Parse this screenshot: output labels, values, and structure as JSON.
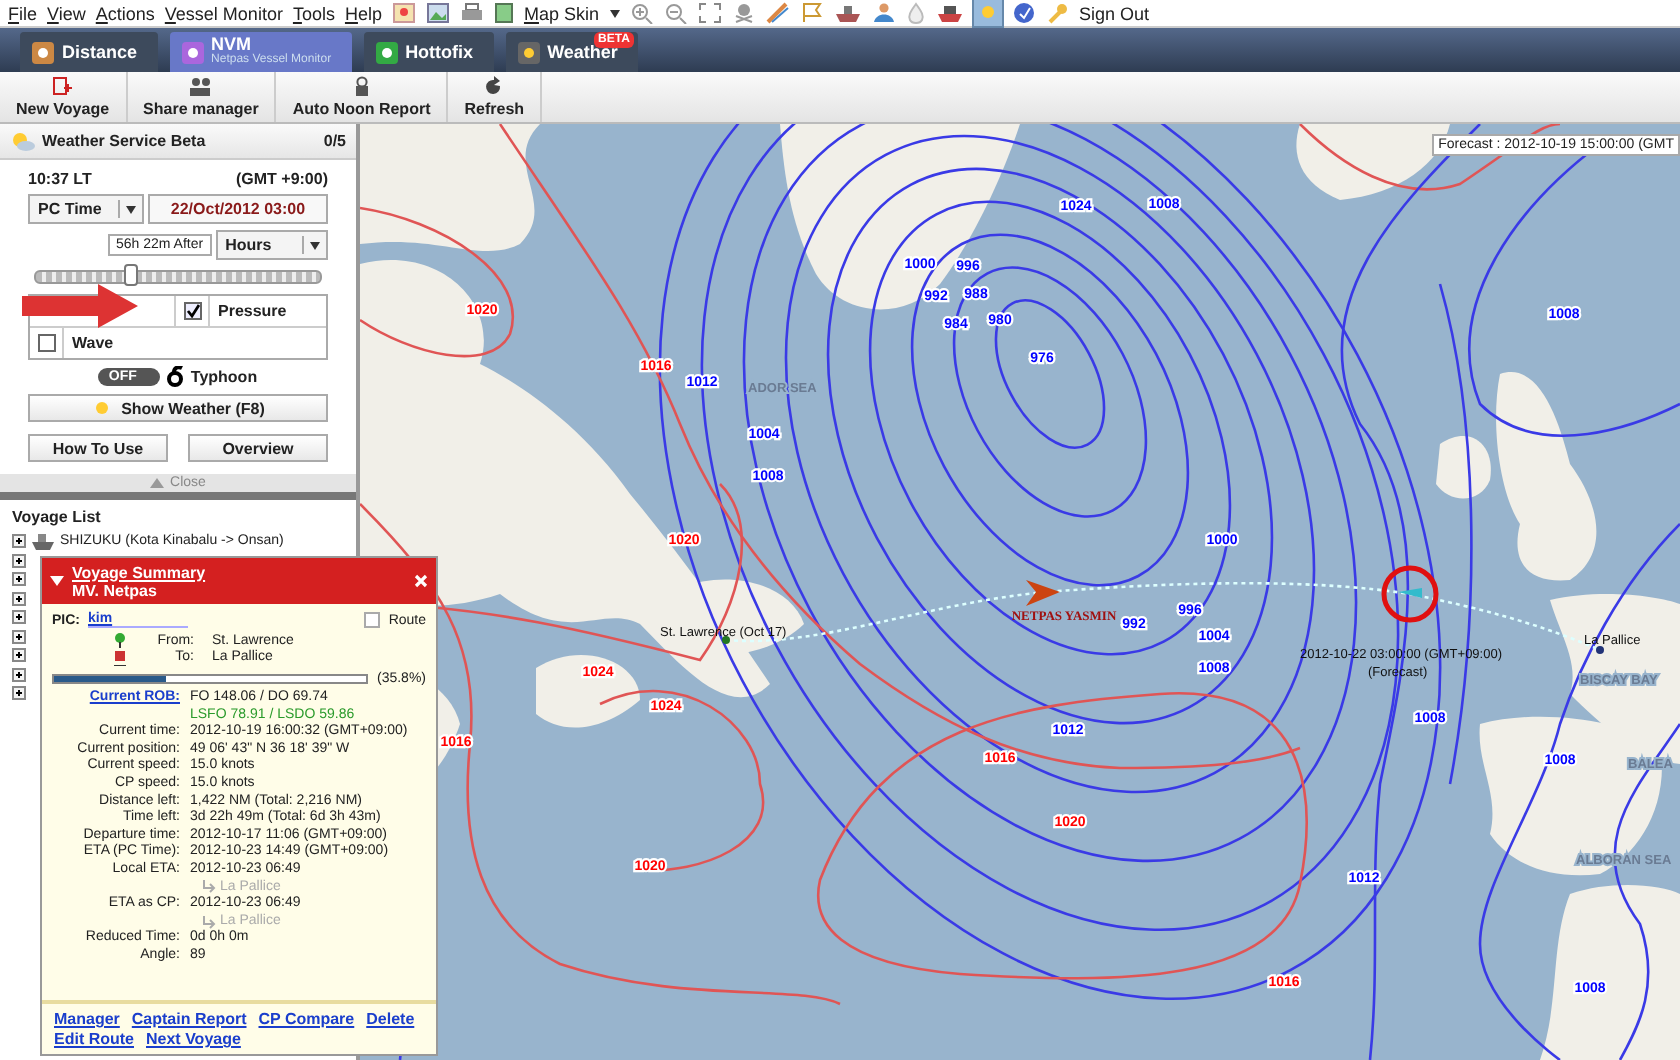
{
  "menu_bar": {
    "items": [
      "File",
      "View",
      "Actions",
      "Vessel Monitor",
      "Tools",
      "Help"
    ],
    "map_skin": "Map Skin",
    "sign_out": "Sign Out"
  },
  "tabs": [
    {
      "label": "Distance",
      "selected": false
    },
    {
      "label": "NVM",
      "sublabel": "Netpas Vessel Monitor",
      "selected": true
    },
    {
      "label": "Hottofix",
      "selected": false
    },
    {
      "label": "Weather",
      "badge": "BETA",
      "selected": false
    }
  ],
  "toolbar": [
    "New Voyage",
    "Share manager",
    "Auto Noon Report",
    "Refresh"
  ],
  "weather_panel": {
    "title": "Weather Service Beta",
    "count": "0/5",
    "local_time": "10:37 LT",
    "gmt": "(GMT +9:00)",
    "time_mode": "PC Time",
    "date": "22/Oct/2012 03:00",
    "offset": "56h 22m After",
    "unit": "Hours",
    "slider": {
      "level": 0.34
    },
    "layers": [
      {
        "label": "Pressure",
        "checked": true
      },
      {
        "label": "Wave",
        "checked": false
      }
    ],
    "typhoon": {
      "switch": "OFF",
      "on": false,
      "label": "Typhoon"
    },
    "show_button": "Show Weather (F8)",
    "buttons": [
      "How To Use",
      "Overview"
    ],
    "close": "Close"
  },
  "voyage_list": {
    "title": "Voyage List",
    "items": [
      {
        "name": "SHIZUKU (Kota Kinabalu -> Onsan)",
        "expanded": false
      },
      {
        "expanded": false
      },
      {
        "expanded": false
      },
      {
        "expanded": false
      },
      {
        "expanded": false
      },
      {
        "expanded": false
      },
      {
        "expanded": false
      },
      {
        "expanded": false
      },
      {
        "expanded": false
      }
    ]
  },
  "voyage_summary": {
    "title": "Voyage Summary",
    "vessel": "MV. Netpas",
    "pic_label": "PIC:",
    "pic": "kim",
    "route": {
      "label": "Route",
      "checked": false
    },
    "from_label": "From:",
    "from": "St. Lawrence",
    "to_label": "To:",
    "to": "La Pallice",
    "progress": {
      "level": 0.358,
      "text": "(35.8%)"
    },
    "rob_label": "Current ROB:",
    "rob": "FO 148.06 / DO 69.74",
    "rob_low_sulfur": "LSFO 78.91 / LSDO 59.86",
    "rows": [
      {
        "label": "Current time:",
        "value": "2012-10-19 16:00:32 (GMT+09:00)"
      },
      {
        "label": "Current position:",
        "value": "49 06' 43\" N  36 18' 39\" W"
      },
      {
        "label": "Current speed:",
        "value": "15.0 knots"
      },
      {
        "label": "CP speed:",
        "value": "15.0 knots"
      },
      {
        "label": "Distance left:",
        "value": "1,422 NM (Total: 2,216 NM)"
      },
      {
        "label": "Time left:",
        "value": "3d 22h 49m (Total: 6d 3h 43m)"
      },
      {
        "label": "Departure time:",
        "value": "2012-10-17 11:06 (GMT+09:00)"
      },
      {
        "label": "ETA (PC Time):",
        "value": "2012-10-23 14:49 (GMT+09:00)"
      },
      {
        "label": "Local ETA:",
        "value": "2012-10-23 06:49",
        "sub": "La Pallice"
      },
      {
        "label": "ETA as CP:",
        "value": "2012-10-23 06:49",
        "sub": "La Pallice"
      },
      {
        "label": "Reduced Time:",
        "value": "0d 0h 0m"
      },
      {
        "label": "Angle:",
        "value": "89"
      }
    ],
    "links": [
      "Manager",
      "Captain Report",
      "CP Compare",
      "Delete",
      "Edit Route",
      "Next Voyage"
    ]
  },
  "map": {
    "forecast": "Forecast : 2012-10-19 15:00:00 (GMT",
    "isobars": [
      {
        "text": "1020",
        "color": "#ff0000"
      },
      {
        "text": "1016",
        "color": "#ff0000"
      },
      {
        "text": "1012",
        "color": "#0000ff"
      },
      {
        "text": "1004",
        "color": "#0000ff"
      },
      {
        "text": "1008",
        "color": "#0000ff"
      },
      {
        "text": "1020",
        "color": "#ff0000"
      },
      {
        "text": "1024",
        "color": "#0000ff"
      },
      {
        "text": "1008",
        "color": "#0000ff"
      },
      {
        "text": "1000",
        "color": "#0000ff"
      },
      {
        "text": "996",
        "color": "#0000ff"
      },
      {
        "text": "992",
        "color": "#0000ff"
      },
      {
        "text": "988",
        "color": "#0000ff"
      },
      {
        "text": "984",
        "color": "#0000ff"
      },
      {
        "text": "980",
        "color": "#0000ff"
      },
      {
        "text": "976",
        "color": "#0000ff"
      },
      {
        "text": "1000",
        "color": "#0000ff"
      },
      {
        "text": "1008",
        "color": "#0000ff"
      },
      {
        "text": "1024",
        "color": "#ff0000"
      },
      {
        "text": "1024",
        "color": "#ff0000"
      },
      {
        "text": "1016",
        "color": "#ff0000"
      },
      {
        "text": "992",
        "color": "#0000ff"
      },
      {
        "text": "996",
        "color": "#0000ff"
      },
      {
        "text": "1004",
        "color": "#0000ff"
      },
      {
        "text": "1008",
        "color": "#0000ff"
      },
      {
        "text": "1012",
        "color": "#0000ff"
      },
      {
        "text": "1016",
        "color": "#ff0000"
      },
      {
        "text": "1020",
        "color": "#ff0000"
      },
      {
        "text": "1020",
        "color": "#ff0000"
      },
      {
        "text": "1016",
        "color": "#ff0000"
      },
      {
        "text": "1012",
        "color": "#0000ff"
      },
      {
        "text": "1008",
        "color": "#0000ff"
      },
      {
        "text": "1008",
        "color": "#0000ff"
      },
      {
        "text": "1008",
        "color": "#0000ff"
      }
    ],
    "seas": [
      "ADOR SEA",
      "BISCAY BAY",
      "BALEA",
      "ALBORAN SEA"
    ],
    "vessel": "NETPAS YASMIN",
    "start": "St. Lawrence (Oct 17)",
    "forecast_time": "2012-10-22 03:00:00 (GMT+09:00)",
    "forecast_note": "(Forecast)",
    "destination": "La Pallice"
  }
}
